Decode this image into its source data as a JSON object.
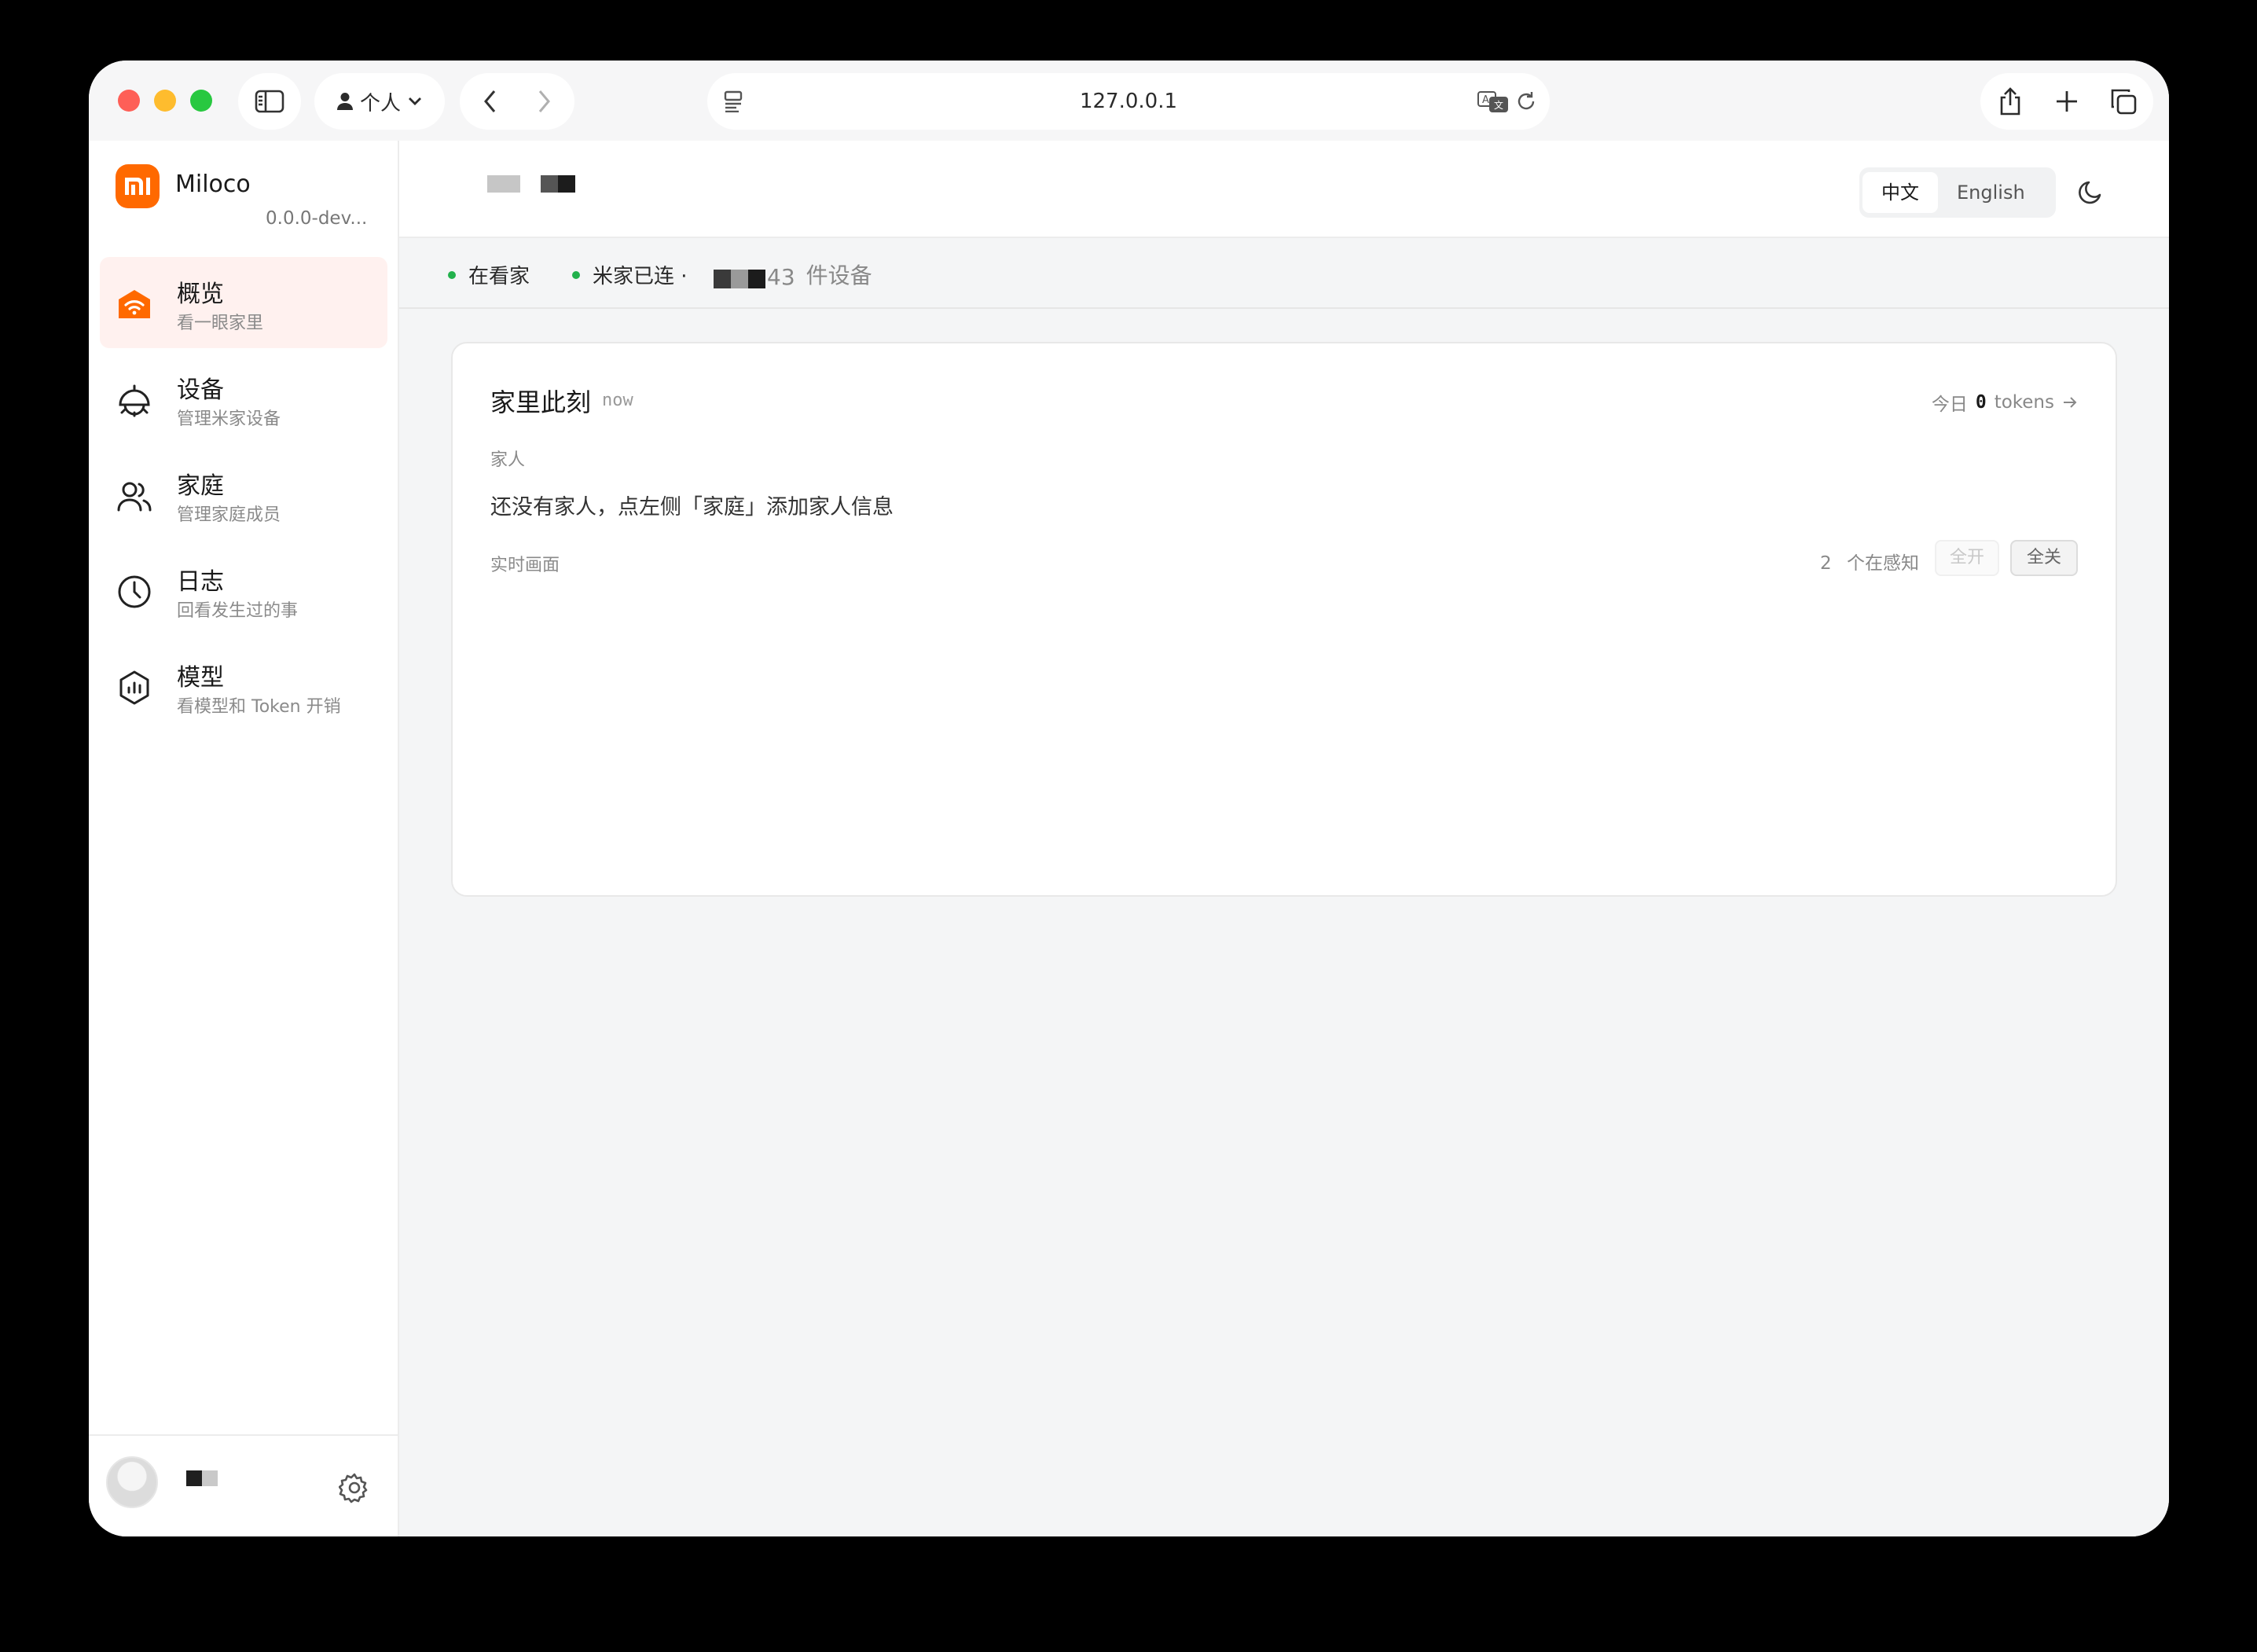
{
  "browser": {
    "profile_label": "个人",
    "url": "127.0.0.1"
  },
  "sidebar": {
    "brand_name": "Miloco",
    "version": "0.0.0-dev...",
    "items": [
      {
        "title": "概览",
        "subtitle": "看一眼家里",
        "icon": "home-wifi-icon",
        "active": true
      },
      {
        "title": "设备",
        "subtitle": "管理米家设备",
        "icon": "ceiling-lamp-icon"
      },
      {
        "title": "家庭",
        "subtitle": "管理家庭成员",
        "icon": "users-icon"
      },
      {
        "title": "日志",
        "subtitle": "回看发生过的事",
        "icon": "clock-icon"
      },
      {
        "title": "模型",
        "subtitle": "看模型和 Token 开销",
        "icon": "model-hexagon-icon"
      }
    ]
  },
  "header": {
    "lang_zh": "中文",
    "lang_en": "English"
  },
  "status": {
    "watching": "在看家",
    "mijia": "米家已连 ·",
    "device_count": "43",
    "device_suffix": "件设备"
  },
  "card": {
    "title": "家里此刻",
    "subtitle": "now",
    "token_prefix": "今日",
    "token_count": "0",
    "token_suffix": "tokens",
    "family_label": "家人",
    "family_empty": "还没有家人，点左侧「家庭」添加家人信息",
    "live_label": "实时画面",
    "sensing_count": "2",
    "sensing_suffix": "个在感知",
    "btn_all_on": "全开",
    "btn_all_off": "全关"
  },
  "colors": {
    "accent": "#ff6900",
    "active_bg": "#fff1ef",
    "status_green": "#22b14c"
  }
}
